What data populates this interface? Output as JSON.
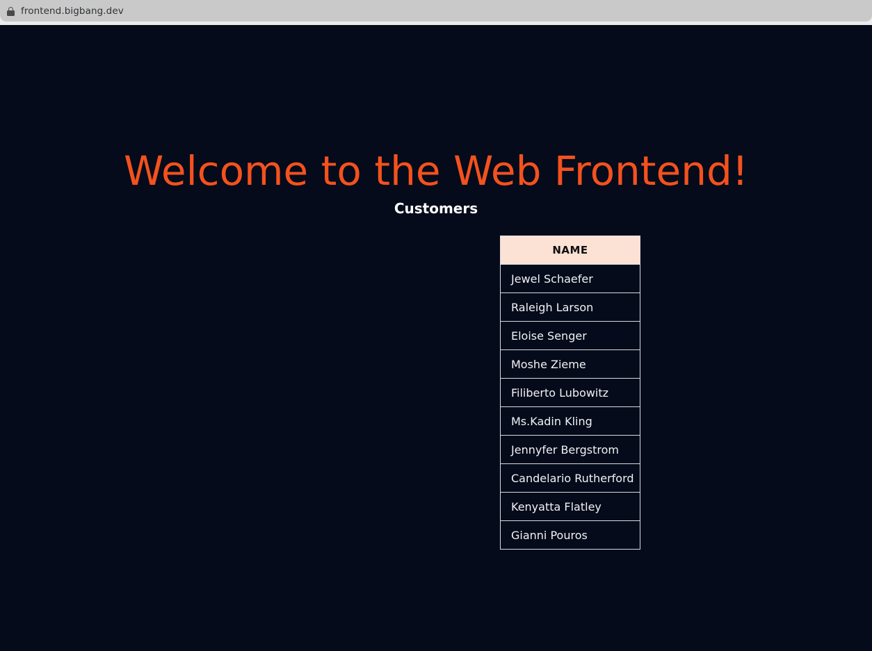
{
  "browser": {
    "url": "frontend.bigbang.dev",
    "lock_icon": "lock-icon"
  },
  "page": {
    "heading": "Welcome to the Web Frontend!",
    "section_heading": "Customers",
    "colors": {
      "background": "#050b1a",
      "heading_accent": "#f4511e",
      "table_header_bg": "#fce2d5",
      "table_border": "#d8dce4",
      "body_text": "#f2f2f6"
    }
  },
  "table": {
    "columns": [
      "NAME"
    ],
    "rows": [
      [
        "Jewel Schaefer"
      ],
      [
        "Raleigh Larson"
      ],
      [
        "Eloise Senger"
      ],
      [
        "Moshe Zieme"
      ],
      [
        "Filiberto Lubowitz"
      ],
      [
        "Ms.Kadin Kling"
      ],
      [
        "Jennyfer Bergstrom"
      ],
      [
        "Candelario Rutherford"
      ],
      [
        "Kenyatta Flatley"
      ],
      [
        "Gianni Pouros"
      ]
    ]
  }
}
